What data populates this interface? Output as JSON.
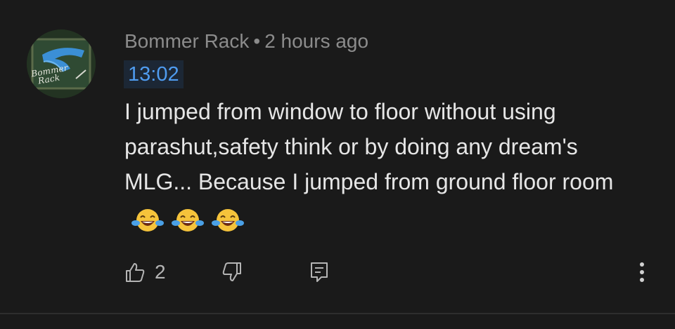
{
  "comment": {
    "author": "Bommer Rack",
    "separator": "•",
    "time_ago": "2 hours ago",
    "timestamp_link": "13:02",
    "text": "I jumped from window to floor without using parashut,safety think or by doing any dream's MLG... Because I jumped from ground floor room",
    "emojis": [
      "face-with-tears-of-joy",
      "face-with-tears-of-joy",
      "face-with-tears-of-joy"
    ],
    "avatar": {
      "line1": "Bommer",
      "line2": "Rack"
    }
  },
  "actions": {
    "like_icon": "thumbs-up-icon",
    "like_count": "2",
    "dislike_icon": "thumbs-down-icon",
    "reply_icon": "comment-icon",
    "more_icon": "more-vertical-icon"
  },
  "colors": {
    "background": "#1a1a1a",
    "text": "#e6e6e6",
    "meta": "#8c8c8c",
    "timestamp": "#4f9cf0",
    "timestamp_bg": "#1c2735"
  }
}
